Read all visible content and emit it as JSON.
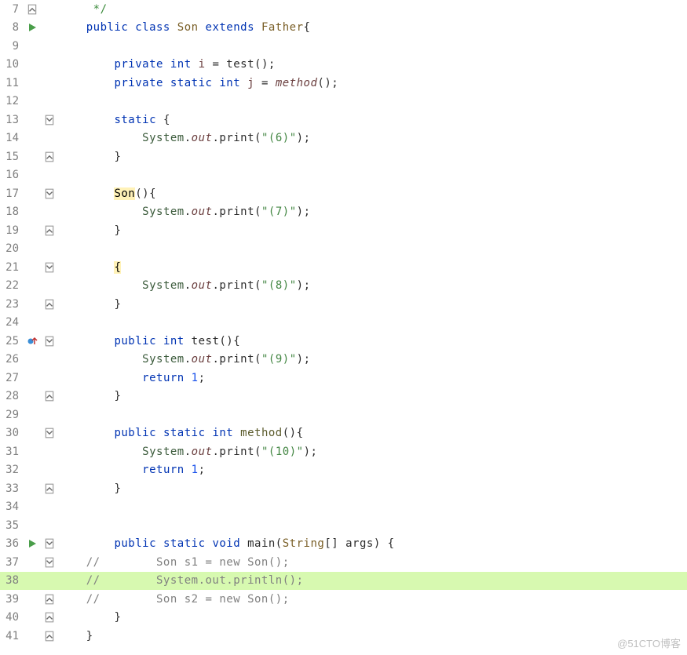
{
  "watermark": "@51CTO博客",
  "lines": [
    {
      "num": 7,
      "mark": "fold-up",
      "fold": "",
      "tokens": [
        [
          "cmtg",
          " */"
        ]
      ]
    },
    {
      "num": 8,
      "mark": "run",
      "fold": "",
      "tokens": [
        [
          "kw",
          "public class "
        ],
        [
          "cls",
          "Son "
        ],
        [
          "kw",
          "extends "
        ],
        [
          "cls",
          "Father"
        ],
        [
          "plain",
          "{"
        ]
      ]
    },
    {
      "num": 9,
      "mark": "",
      "fold": "",
      "tokens": []
    },
    {
      "num": 10,
      "mark": "",
      "fold": "",
      "indent": 2,
      "tokens": [
        [
          "kw",
          "private int "
        ],
        [
          "fld",
          "i "
        ],
        [
          "plain",
          "= test();"
        ]
      ]
    },
    {
      "num": 11,
      "mark": "",
      "fold": "",
      "indent": 2,
      "tokens": [
        [
          "kw",
          "private static int "
        ],
        [
          "fld",
          "j "
        ],
        [
          "plain",
          "= "
        ],
        [
          "fldi",
          "method"
        ],
        [
          "plain",
          "();"
        ]
      ]
    },
    {
      "num": 12,
      "mark": "",
      "fold": "",
      "tokens": []
    },
    {
      "num": 13,
      "mark": "",
      "fold": "fold-dn",
      "indent": 2,
      "tokens": [
        [
          "kw",
          "static "
        ],
        [
          "plain",
          "{"
        ]
      ]
    },
    {
      "num": 14,
      "mark": "",
      "fold": "",
      "indent": 3,
      "tokens": [
        [
          "qual",
          "System"
        ],
        [
          "plain",
          "."
        ],
        [
          "fldi",
          "out"
        ],
        [
          "plain",
          ".print("
        ],
        [
          "str",
          "\"(6)\""
        ],
        [
          "plain",
          ");"
        ]
      ]
    },
    {
      "num": 15,
      "mark": "",
      "fold": "fold-up",
      "indent": 2,
      "tokens": [
        [
          "plain",
          "}"
        ]
      ]
    },
    {
      "num": 16,
      "mark": "",
      "fold": "",
      "tokens": []
    },
    {
      "num": 17,
      "mark": "",
      "fold": "fold-dn",
      "indent": 2,
      "tokens": [
        [
          "hlbox",
          "Son"
        ],
        [
          "plain",
          "(){"
        ]
      ]
    },
    {
      "num": 18,
      "mark": "",
      "fold": "",
      "indent": 3,
      "tokens": [
        [
          "qual",
          "System"
        ],
        [
          "plain",
          "."
        ],
        [
          "fldi",
          "out"
        ],
        [
          "plain",
          ".print("
        ],
        [
          "str",
          "\"(7)\""
        ],
        [
          "plain",
          ");"
        ]
      ]
    },
    {
      "num": 19,
      "mark": "",
      "fold": "fold-up",
      "indent": 2,
      "tokens": [
        [
          "plain",
          "}"
        ]
      ]
    },
    {
      "num": 20,
      "mark": "",
      "fold": "",
      "tokens": []
    },
    {
      "num": 21,
      "mark": "",
      "fold": "fold-dn",
      "indent": 2,
      "tokens": [
        [
          "hlbox",
          "{"
        ]
      ]
    },
    {
      "num": 22,
      "mark": "",
      "fold": "",
      "indent": 3,
      "tokens": [
        [
          "qual",
          "System"
        ],
        [
          "plain",
          "."
        ],
        [
          "fldi",
          "out"
        ],
        [
          "plain",
          ".print("
        ],
        [
          "str",
          "\"(8)\""
        ],
        [
          "plain",
          ");"
        ]
      ]
    },
    {
      "num": 23,
      "mark": "",
      "fold": "fold-up",
      "indent": 2,
      "tokens": [
        [
          "plain",
          "}"
        ]
      ]
    },
    {
      "num": 24,
      "mark": "",
      "fold": "",
      "tokens": []
    },
    {
      "num": 25,
      "mark": "override",
      "fold": "fold-dn",
      "indent": 2,
      "tokens": [
        [
          "kw",
          "public int "
        ],
        [
          "plain",
          "test(){"
        ]
      ]
    },
    {
      "num": 26,
      "mark": "",
      "fold": "",
      "indent": 3,
      "tokens": [
        [
          "qual",
          "System"
        ],
        [
          "plain",
          "."
        ],
        [
          "fldi",
          "out"
        ],
        [
          "plain",
          ".print("
        ],
        [
          "str",
          "\"(9)\""
        ],
        [
          "plain",
          ");"
        ]
      ]
    },
    {
      "num": 27,
      "mark": "",
      "fold": "",
      "indent": 3,
      "tokens": [
        [
          "kw",
          "return "
        ],
        [
          "num",
          "1"
        ],
        [
          "plain",
          ";"
        ]
      ]
    },
    {
      "num": 28,
      "mark": "",
      "fold": "fold-up",
      "indent": 2,
      "tokens": [
        [
          "plain",
          "}"
        ]
      ]
    },
    {
      "num": 29,
      "mark": "",
      "fold": "",
      "tokens": []
    },
    {
      "num": 30,
      "mark": "",
      "fold": "fold-dn",
      "indent": 2,
      "tokens": [
        [
          "kw",
          "public static int "
        ],
        [
          "mtd",
          "method"
        ],
        [
          "plain",
          "(){"
        ]
      ]
    },
    {
      "num": 31,
      "mark": "",
      "fold": "",
      "indent": 3,
      "tokens": [
        [
          "qual",
          "System"
        ],
        [
          "plain",
          "."
        ],
        [
          "fldi",
          "out"
        ],
        [
          "plain",
          ".print("
        ],
        [
          "str",
          "\"(10)\""
        ],
        [
          "plain",
          ");"
        ]
      ]
    },
    {
      "num": 32,
      "mark": "",
      "fold": "",
      "indent": 3,
      "tokens": [
        [
          "kw",
          "return "
        ],
        [
          "num",
          "1"
        ],
        [
          "plain",
          ";"
        ]
      ]
    },
    {
      "num": 33,
      "mark": "",
      "fold": "fold-up",
      "indent": 2,
      "tokens": [
        [
          "plain",
          "}"
        ]
      ]
    },
    {
      "num": 34,
      "mark": "",
      "fold": "",
      "tokens": []
    },
    {
      "num": 35,
      "mark": "",
      "fold": "",
      "tokens": []
    },
    {
      "num": 36,
      "mark": "run",
      "fold": "fold-dn",
      "indent": 2,
      "tokens": [
        [
          "kw",
          "public static void "
        ],
        [
          "plain",
          "main("
        ],
        [
          "cls",
          "String"
        ],
        [
          "plain",
          "[] args) {"
        ]
      ]
    },
    {
      "num": 37,
      "mark": "",
      "fold": "fold-dn",
      "indent": 0,
      "tokens": [
        [
          "cmt",
          "//        Son s1 = new Son();"
        ]
      ]
    },
    {
      "num": 38,
      "mark": "",
      "fold": "",
      "hl": true,
      "indent": 0,
      "tokens": [
        [
          "cmt",
          "//        System.out.println("
        ],
        [
          "caret",
          ""
        ],
        [
          "cmt",
          ");"
        ]
      ]
    },
    {
      "num": 39,
      "mark": "",
      "fold": "fold-up",
      "indent": 0,
      "tokens": [
        [
          "cmt",
          "//        Son s2 = new Son();"
        ]
      ]
    },
    {
      "num": 40,
      "mark": "",
      "fold": "fold-up",
      "indent": 2,
      "tokens": [
        [
          "plain",
          "}"
        ]
      ]
    },
    {
      "num": 41,
      "mark": "",
      "fold": "fold-up",
      "indent": 1,
      "tokens": [
        [
          "plain",
          "}"
        ]
      ]
    }
  ]
}
